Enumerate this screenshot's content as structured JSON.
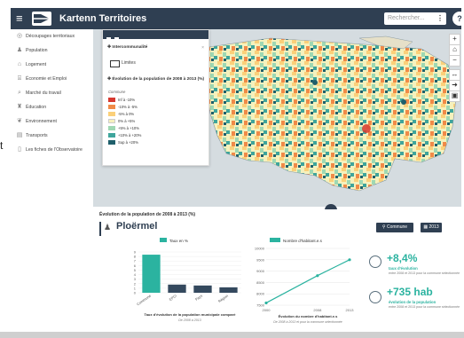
{
  "app": {
    "title": "Kartenn Territoires",
    "search_placeholder": "Rechercher...",
    "help": "?"
  },
  "sidebar": {
    "items": [
      {
        "label": "Découpages territoriaux",
        "icon": "globe-icon"
      },
      {
        "label": "Population",
        "icon": "people-icon"
      },
      {
        "label": "Logement",
        "icon": "home-icon"
      },
      {
        "label": "Économie et Emploi",
        "icon": "bank-icon"
      },
      {
        "label": "Marché du travail",
        "icon": "search-icon"
      },
      {
        "label": "Éducation",
        "icon": "graduation-icon"
      },
      {
        "label": "Environnement",
        "icon": "leaf-icon"
      },
      {
        "label": "Transports",
        "icon": "bus-icon"
      },
      {
        "label": "Les fiches de l'Observatoire",
        "icon": "document-icon"
      }
    ],
    "cut_text": "t"
  },
  "legend": {
    "section1": "Intercommunalité",
    "limits": "Limites",
    "section2": "Évolution de la population de 2008 à 2013 (%)",
    "sub": "Commune",
    "classes": [
      {
        "label": "Inf à -10%",
        "color": "#d7382f"
      },
      {
        "label": "-10% à -5%",
        "color": "#f08a48"
      },
      {
        "label": "-5% à 0%",
        "color": "#fbd07a"
      },
      {
        "label": "0% à +5%",
        "color": "#f5f1bd"
      },
      {
        "label": "+5% à +10%",
        "color": "#9fd8b3"
      },
      {
        "label": "+10% à +20%",
        "color": "#3ea59c"
      },
      {
        "label": "Sup à +20%",
        "color": "#1f5f6b"
      }
    ]
  },
  "map_controls": [
    "+",
    "⌂",
    "−",
    "↔",
    "➜",
    "▣"
  ],
  "panel": {
    "heading": "Évolution de la population de 2008 à 2013 (%)",
    "city": "Ploërmel",
    "btn_commune": "Commune",
    "btn_year": "2013"
  },
  "bar_chart": {
    "type": "bar",
    "legend": "Taux en %",
    "categories": [
      "Commune",
      "EPCI",
      "Pays",
      "Région"
    ],
    "values": [
      8.4,
      1.8,
      1.6,
      1.2
    ],
    "ylim": [
      0,
      9
    ],
    "yticks": [
      0,
      1,
      2,
      3,
      4,
      5,
      6,
      7,
      8,
      9
    ],
    "title": "Taux d'évolution de la population municipale comparé",
    "subtitle": "De 2008 à 2013",
    "colors": {
      "highlight": "#2bb3a0",
      "other": "#34495e"
    }
  },
  "line_chart": {
    "type": "line",
    "legend": "Nombre d'habitant.e.s",
    "x": [
      2000,
      2008,
      2013
    ],
    "y": [
      7600,
      8800,
      9500
    ],
    "ylim": [
      7500,
      10000
    ],
    "yticks": [
      7500,
      8000,
      8500,
      9000,
      9500,
      10000
    ],
    "title": "Évolution du nombre d'habitant.e.s",
    "subtitle": "De 2008 à 2013 et pour la commune sélectionnée",
    "color": "#2bb3a0"
  },
  "kpis": [
    {
      "value": "+8,4%",
      "label": "taux d'évolution",
      "note": "entre 2008 et 2013 pour la commune sélectionnée"
    },
    {
      "value": "+735 hab",
      "label": "évolution de la population",
      "note": "entre 2008 et 2013 pour la commune sélectionnée"
    }
  ]
}
